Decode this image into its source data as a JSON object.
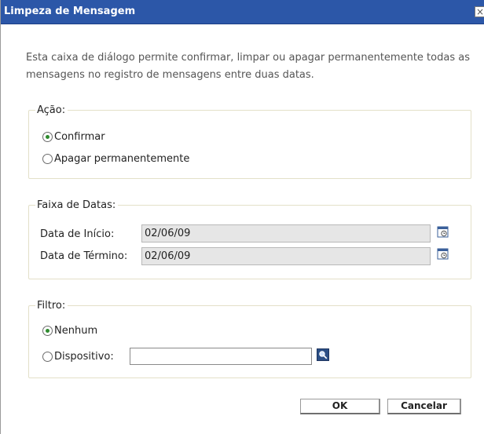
{
  "dialog": {
    "title": "Limpeza de Mensagem",
    "close_glyph": "×",
    "description": "Esta caixa de diálogo permite confirmar, limpar ou apagar permanentemente todas as mensagens no registro de mensagens entre duas datas."
  },
  "action": {
    "legend": "Ação:",
    "options": [
      {
        "label": "Confirmar",
        "checked": true
      },
      {
        "label": "Apagar permanentemente",
        "checked": false
      }
    ]
  },
  "date_range": {
    "legend": "Faixa de Datas:",
    "start_label": "Data de Início:",
    "start_value": "02/06/09",
    "end_label": "Data de Término:",
    "end_value": "02/06/09"
  },
  "filter": {
    "legend": "Filtro:",
    "options": [
      {
        "label": "Nenhum",
        "checked": true
      },
      {
        "label": "Dispositivo:",
        "checked": false
      }
    ],
    "device_value": ""
  },
  "buttons": {
    "ok": "OK",
    "cancel": "Cancelar"
  },
  "icons": {
    "calendar": "calendar-icon",
    "search": "search-icon",
    "close": "close-icon"
  },
  "colors": {
    "titlebar": "#2c57a8",
    "radio_selected": "#2e8b2e",
    "fieldset_border": "#e3e0c8"
  }
}
